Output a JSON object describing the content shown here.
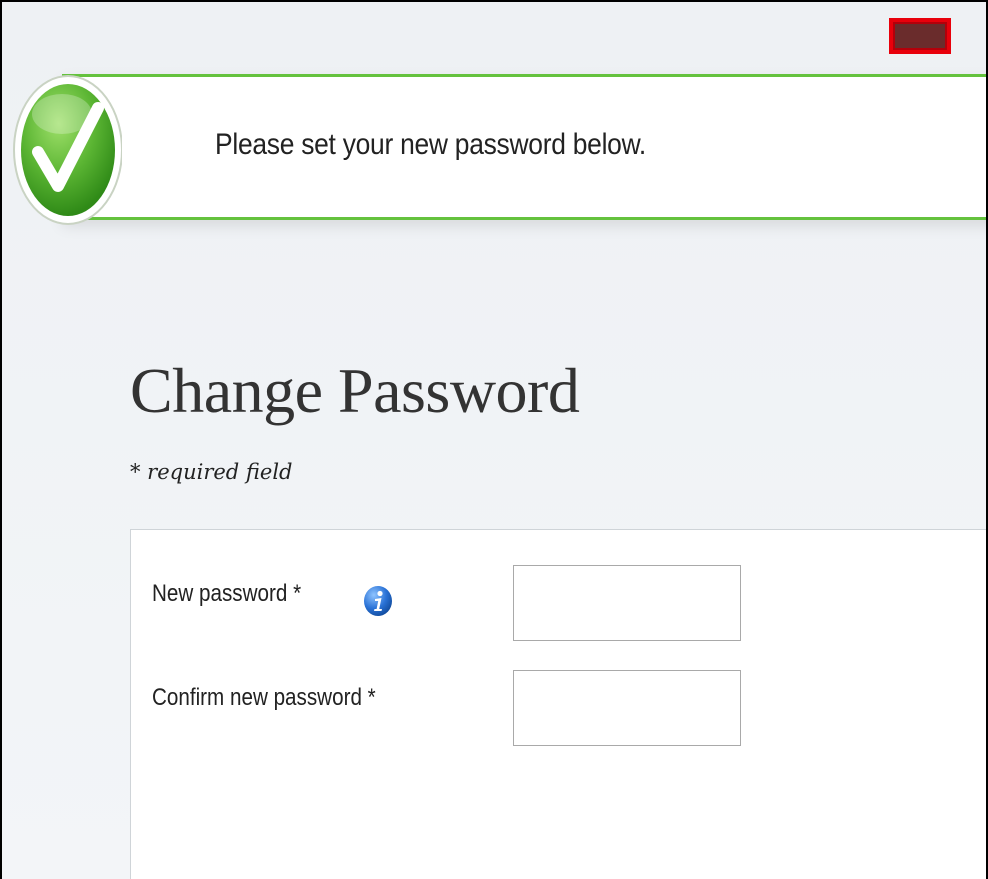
{
  "banner": {
    "message": "Please set your new password below.",
    "icon": "checkmark-icon",
    "accent_color": "#64c23d"
  },
  "page": {
    "title": "Change Password",
    "required_note": "* required field"
  },
  "form": {
    "new_password_label": "New password *",
    "new_password_info_icon": "info-icon",
    "new_password_value": "",
    "confirm_password_label": "Confirm new password *",
    "confirm_password_value": ""
  },
  "marker": {
    "color": "#e8000b"
  }
}
